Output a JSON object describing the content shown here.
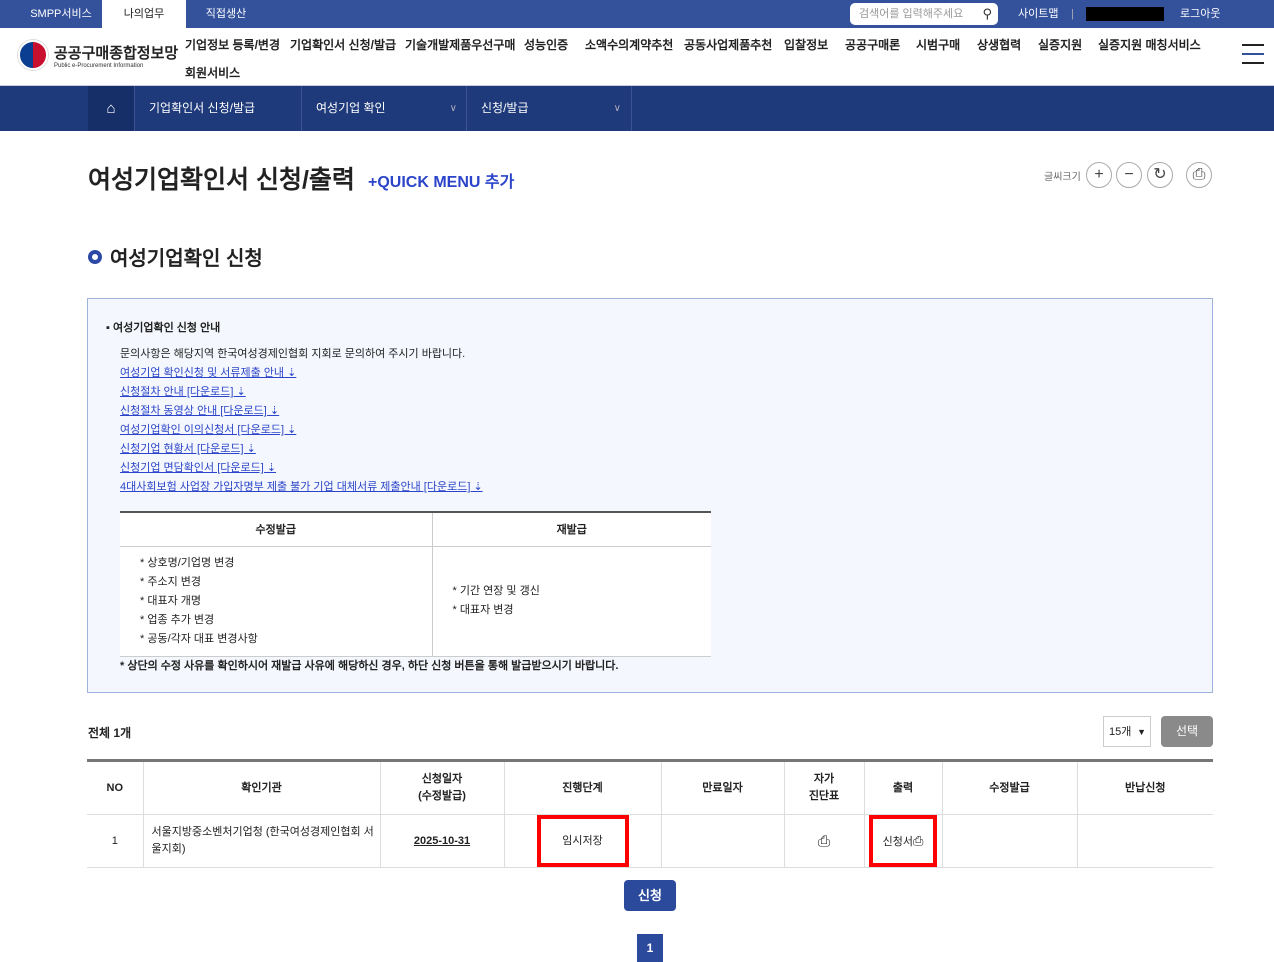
{
  "topbar": {
    "tabs": [
      "SMPP서비스",
      "나의업무",
      "직접생산"
    ],
    "search_placeholder": "검색어를 입력해주세요",
    "sitemap": "사이트맵",
    "logout": "로그아웃"
  },
  "logo": {
    "title": "공공구매종합정보망",
    "subtitle": "Public e-Procurement Information"
  },
  "gnb": [
    "기업정보 등록/변경",
    "기업확인서 신청/발급",
    "기술개발제품우선구매",
    "성능인증",
    "소액수의계약추천",
    "공동사업제품추천",
    "입찰정보",
    "공공구매론",
    "시범구매",
    "상생협력",
    "실증지원",
    "실증지원 매칭서비스",
    "회원서비스"
  ],
  "subnav": [
    "기업확인서 신청/발급",
    "여성기업 확인",
    "신청/발급"
  ],
  "page": {
    "title": "여성기업확인서 신청/출력",
    "quick_menu": "+QUICK MENU 추가",
    "font_size_label": "글씨크기",
    "section_title": "여성기업확인 신청"
  },
  "info": {
    "title": "여성기업확인 신청 안내",
    "desc": "문의사항은 해당지역 한국여성경제인협회 지회로 문의하여 주시기 바랍니다.",
    "links": [
      "여성기업 확인신청 및 서류제출 안내 ⇣",
      "신청절차 안내 [다운로드] ⇣",
      "신청절차 동영상 안내 [다운로드] ⇣",
      "여성기업확인 이의신청서 [다운로드] ⇣",
      "신청기업 현황서 [다운로드] ⇣",
      "신청기업 면담확인서 [다운로드] ⇣",
      "4대사회보험 사업장 가입자명부 제출 불가 기업 대체서류 제출안내 [다운로드] ⇣"
    ],
    "table_headers": [
      "수정발급",
      "재발급"
    ],
    "modify_items": [
      "* 상호명/기업명 변경",
      "* 주소지 변경",
      "* 대표자 개명",
      "* 업종 추가 변경",
      "* 공동/각자 대표 변경사항"
    ],
    "reissue_items": [
      "* 기간 연장 및 갱신",
      "* 대표자 변경"
    ],
    "note": "* 상단의 수정 사유를 확인하시어 재발급 사유에 해당하신 경우, 하단 신청 버튼을 통해 발급받으시기 바랍니다."
  },
  "list": {
    "total": "전체 1개",
    "page_size": "15개",
    "select_btn": "선택",
    "headers": [
      "NO",
      "확인기관",
      "신청일자\n(수정발급)",
      "진행단계",
      "만료일자",
      "자가\n진단표",
      "출력",
      "수정발급",
      "반납신청"
    ],
    "rows": [
      {
        "no": "1",
        "agency": "서울지방중소벤처기업청 (한국여성경제인협회 서울지회)",
        "date": "2025-10-31",
        "stage": "임시저장",
        "expiry": "",
        "print_label": "신청서",
        "modify": "",
        "return": ""
      }
    ]
  },
  "apply_btn": "신청",
  "pagination": [
    "1"
  ]
}
